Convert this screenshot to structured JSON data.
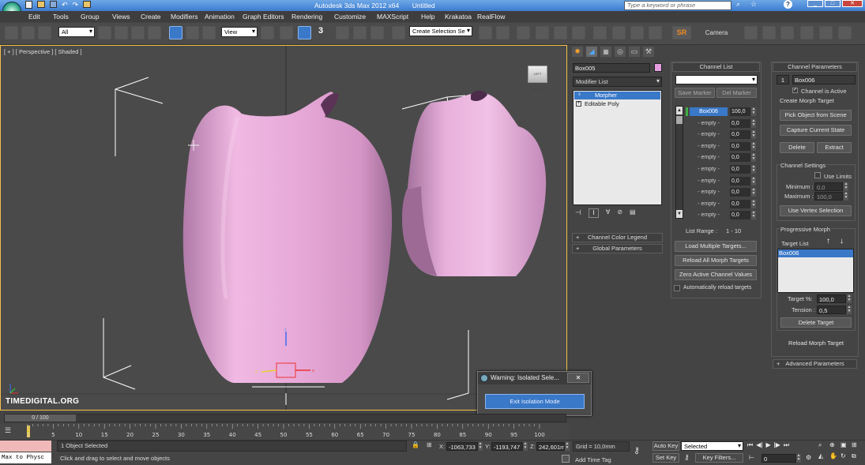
{
  "title": {
    "app": "Autodesk 3ds Max  2012 x64",
    "file": "Untitled"
  },
  "search": {
    "placeholder": "Type a keyword or phrase"
  },
  "menu": [
    "Edit",
    "Tools",
    "Group",
    "Views",
    "Create",
    "Modifiers",
    "Animation",
    "Graph Editors",
    "Rendering",
    "Customize",
    "MAXScript",
    "Help",
    "Krakatoa",
    "RealFlow"
  ],
  "toolbar": {
    "selection_filter": "All",
    "ref_coord": "View",
    "named_selection": "Create Selection Se",
    "sr_label": "SR",
    "camera_label": "Camera",
    "snap_value": "3"
  },
  "viewport": {
    "label": "[ + ] [ Perspective ] [ Shaded ]",
    "watermark": "TIMEDIGITAL.ORG",
    "viewcube": "LEFT FRONT"
  },
  "modify": {
    "object_name": "Box005",
    "modifier_list": "Modifier List",
    "stack": [
      "Morpher",
      "Editable Poly"
    ],
    "rollouts": [
      "Channel Color Legend",
      "Global Parameters"
    ]
  },
  "channel_list": {
    "header": "Channel List",
    "save_marker": "Save Marker",
    "del_marker": "Del Marker",
    "channels": [
      {
        "name": "Box006",
        "value": "100,0"
      },
      {
        "name": "- empty -",
        "value": "0,0"
      },
      {
        "name": "- empty -",
        "value": "0,0"
      },
      {
        "name": "- empty -",
        "value": "0,0"
      },
      {
        "name": "- empty -",
        "value": "0,0"
      },
      {
        "name": "- empty -",
        "value": "0,0"
      },
      {
        "name": "- empty -",
        "value": "0,0"
      },
      {
        "name": "- empty -",
        "value": "0,0"
      },
      {
        "name": "- empty -",
        "value": "0,0"
      },
      {
        "name": "- empty -",
        "value": "0,0"
      }
    ],
    "list_range_label": "List Range :",
    "list_range": "1 - 10",
    "load_multiple": "Load Multiple Targets...",
    "reload_all": "Reload All Morph Targets",
    "zero_active": "Zero Active Channel Values",
    "auto_reload": "Automatically reload targets"
  },
  "channel_params": {
    "header": "Channel Parameters",
    "index": "1",
    "target_name": "Box006",
    "channel_active": "Channel is Active",
    "create_target_label": "Create Morph Target",
    "pick_object": "Pick Object from Scene",
    "capture_state": "Capture Current State",
    "delete": "Delete",
    "extract": "Extract",
    "channel_settings": "Channel Settings",
    "use_limits": "Use Limits",
    "minimum_label": "Minimum :",
    "minimum": "0,0",
    "maximum_label": "Maximum :",
    "maximum": "100,0",
    "use_vertex_sel": "Use Vertex Selection",
    "progressive": "Progressive Morph",
    "target_list_label": "Target List",
    "target_list": [
      "Box006"
    ],
    "target_pct_label": "Target %:",
    "target_pct": "100,0",
    "tension_label": "Tension :",
    "tension": "0,5",
    "delete_target": "Delete Target",
    "reload_target": "Reload Morph Target",
    "advanced": "Advanced Parameters"
  },
  "dialog": {
    "title": "Warning: Isolated Sele...",
    "button": "Exit Isolation Mode"
  },
  "timeline": {
    "slider": "0 / 100",
    "ticks": [
      "0",
      "5",
      "10",
      "15",
      "20",
      "25",
      "30",
      "35",
      "40",
      "45",
      "50",
      "55",
      "60",
      "65",
      "70",
      "75",
      "80",
      "85",
      "90",
      "95",
      "100"
    ]
  },
  "status": {
    "maxscript": "Max to Physc",
    "selected": "1 Object Selected",
    "prompt": "Click and drag to select and move objects",
    "x_label": "X:",
    "x": "-1063,733",
    "y_label": "Y:",
    "y": "-1193,747",
    "z_label": "Z:",
    "z": "242,601m",
    "grid": "Grid = 10,0mm",
    "add_time_tag": "Add Time Tag",
    "auto_key": "Auto Key",
    "set_key": "Set Key",
    "key_mode": "Selected",
    "key_filters": "Key Filters...",
    "frame": "0"
  },
  "colors": {
    "accent": "#3a78c8",
    "object": "#e9b3de",
    "panel": "#444444",
    "viewport": "#4a4a4a",
    "swatch": "#e59ddf"
  }
}
